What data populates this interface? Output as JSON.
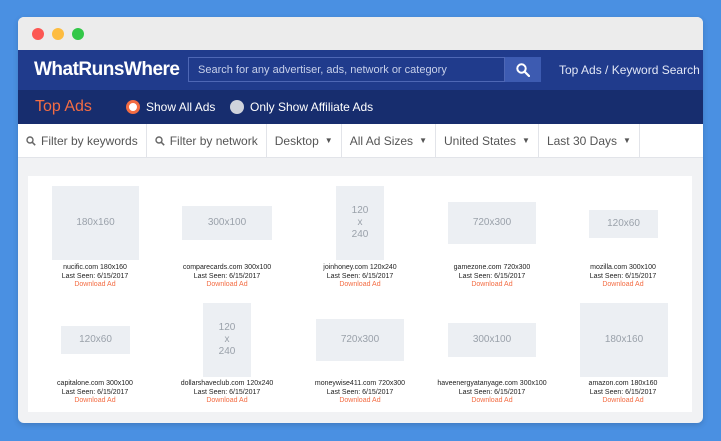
{
  "app": {
    "logo": "WhatRunsWhere",
    "search_placeholder": "Search for any advertiser, ads, network or category",
    "top_link": "Top Ads / Keyword Search"
  },
  "subnav": {
    "title": "Top Ads",
    "option_all": "Show All Ads",
    "option_affiliate": "Only Show Affiliate Ads"
  },
  "filters": {
    "keywords": "Filter by keywords",
    "network": "Filter by network",
    "device": "Desktop",
    "sizes": "All Ad Sizes",
    "country": "United States",
    "period": "Last 30 Days"
  },
  "colors": {
    "accent": "#f36c43",
    "nav": "#203b8c",
    "subnav": "#172d6e"
  },
  "ads": [
    {
      "size_line1": "180x160",
      "size_line2": "",
      "size_line3": "",
      "caption": "nucific.com 180x160",
      "last_seen": "Last Seen: 6/15/2017",
      "download": "Download Ad"
    },
    {
      "size_line1": "300x100",
      "size_line2": "",
      "size_line3": "",
      "caption": "comparecards.com 300x100",
      "last_seen": "Last Seen: 6/15/2017",
      "download": "Download Ad"
    },
    {
      "size_line1": "120",
      "size_line2": "x",
      "size_line3": "240",
      "caption": "joinhoney.com 120x240",
      "last_seen": "Last Seen: 6/15/2017",
      "download": "Download Ad"
    },
    {
      "size_line1": "720x300",
      "size_line2": "",
      "size_line3": "",
      "caption": "gamezone.com 720x300",
      "last_seen": "Last Seen: 6/15/2017",
      "download": "Download Ad"
    },
    {
      "size_line1": "120x60",
      "size_line2": "",
      "size_line3": "",
      "caption": "mozilla.com 300x100",
      "last_seen": "Last Seen: 6/15/2017",
      "download": "Download Ad"
    },
    {
      "size_line1": "120x60",
      "size_line2": "",
      "size_line3": "",
      "caption": "capitalone.com 300x100",
      "last_seen": "Last Seen: 6/15/2017",
      "download": "Download Ad"
    },
    {
      "size_line1": "120",
      "size_line2": "x",
      "size_line3": "240",
      "caption": "dollarshaveclub.com 120x240",
      "last_seen": "Last Seen: 6/15/2017",
      "download": "Download Ad"
    },
    {
      "size_line1": "720x300",
      "size_line2": "",
      "size_line3": "",
      "caption": "moneywise411.com 720x300",
      "last_seen": "Last Seen: 6/15/2017",
      "download": "Download Ad"
    },
    {
      "size_line1": "300x100",
      "size_line2": "",
      "size_line3": "",
      "caption": "haveenergyatanyage.com 300x100",
      "last_seen": "Last Seen: 6/15/2017",
      "download": "Download Ad"
    },
    {
      "size_line1": "180x160",
      "size_line2": "",
      "size_line3": "",
      "caption": "amazon.com 180x160",
      "last_seen": "Last Seen: 6/15/2017",
      "download": "Download Ad"
    }
  ]
}
